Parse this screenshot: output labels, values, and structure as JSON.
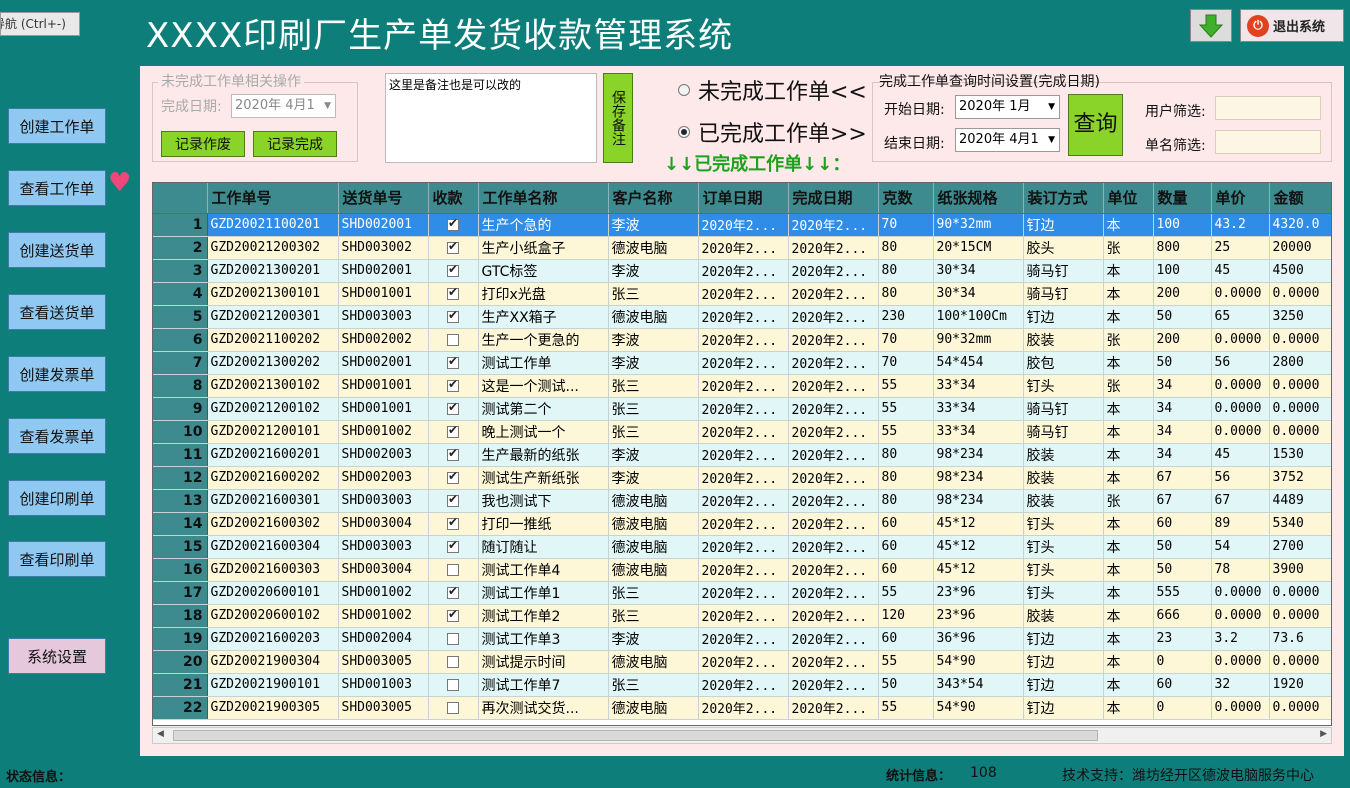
{
  "nav_hint": "导航 (Ctrl+-)",
  "title": "XXXX印刷厂生产单发货收款管理系统",
  "exit_label": "退出系统",
  "sidebar": [
    {
      "label": "创建工作单"
    },
    {
      "label": "查看工作单"
    },
    {
      "label": "创建送货单"
    },
    {
      "label": "查看送货单"
    },
    {
      "label": "创建发票单"
    },
    {
      "label": "查看发票单"
    },
    {
      "label": "创建印刷单"
    },
    {
      "label": "查看印刷单"
    }
  ],
  "settings_label": "系统设置",
  "unfinished": {
    "group_title": "未完成工作单相关操作",
    "date_label": "完成日期:",
    "date_value": "2020年 4月1",
    "void_label": "记录作废",
    "complete_label": "记录完成"
  },
  "memo": {
    "text": "这里是备注也是可以改的",
    "save_label": "保存备注"
  },
  "radios": {
    "unfinished_label": "未完成工作单<<",
    "finished_label": "已完成工作单>>",
    "selected": "finished",
    "banner": "↓↓已完成工作单↓↓："
  },
  "query": {
    "group_title": "完成工作单查询时间设置(完成日期)",
    "start_label": "开始日期:",
    "start_value": "2020年 1月",
    "end_label": "结束日期:",
    "end_value": "2020年 4月1",
    "button_label": "查询",
    "user_filter_label": "用户筛选:",
    "name_filter_label": "单名筛选:"
  },
  "grid": {
    "columns": [
      "",
      "工作单号",
      "送货单号",
      "收款",
      "工作单名称",
      "客户名称",
      "订单日期",
      "完成日期",
      "克数",
      "纸张规格",
      "装订方式",
      "单位",
      "数量",
      "单价",
      "金额"
    ],
    "rows": [
      [
        "1",
        "GZD20021100201",
        "SHD002001",
        true,
        "生产个急的",
        "李波",
        "2020年2...",
        "2020年2...",
        "70",
        "90*32mm",
        "钉边",
        "本",
        "100",
        "43.2",
        "4320.0"
      ],
      [
        "2",
        "GZD20021200302",
        "SHD003002",
        true,
        "生产小纸盒子",
        "德波电脑",
        "2020年2...",
        "2020年2...",
        "80",
        "20*15CM",
        "胶头",
        "张",
        "800",
        "25",
        "20000"
      ],
      [
        "3",
        "GZD20021300201",
        "SHD002001",
        true,
        "GTC标签",
        "李波",
        "2020年2...",
        "2020年2...",
        "80",
        "30*34",
        "骑马钉",
        "本",
        "100",
        "45",
        "4500"
      ],
      [
        "4",
        "GZD20021300101",
        "SHD001001",
        true,
        "打印x光盘",
        "张三",
        "2020年2...",
        "2020年2...",
        "80",
        "30*34",
        "骑马钉",
        "本",
        "200",
        "0.0000",
        "0.0000"
      ],
      [
        "5",
        "GZD20021200301",
        "SHD003003",
        true,
        "生产XX箱子",
        "德波电脑",
        "2020年2...",
        "2020年2...",
        "230",
        "100*100Cm",
        "钉边",
        "本",
        "50",
        "65",
        "3250"
      ],
      [
        "6",
        "GZD20021100202",
        "SHD002002",
        false,
        "生产一个更急的",
        "李波",
        "2020年2...",
        "2020年2...",
        "70",
        "90*32mm",
        "胶装",
        "张",
        "200",
        "0.0000",
        "0.0000"
      ],
      [
        "7",
        "GZD20021300202",
        "SHD002001",
        true,
        "测试工作单",
        "李波",
        "2020年2...",
        "2020年2...",
        "70",
        "54*454",
        "胶包",
        "本",
        "50",
        "56",
        "2800"
      ],
      [
        "8",
        "GZD20021300102",
        "SHD001001",
        true,
        "这是一个测试...",
        "张三",
        "2020年2...",
        "2020年2...",
        "55",
        "33*34",
        "钉头",
        "张",
        "34",
        "0.0000",
        "0.0000"
      ],
      [
        "9",
        "GZD20021200102",
        "SHD001001",
        true,
        "测试第二个",
        "张三",
        "2020年2...",
        "2020年2...",
        "55",
        "33*34",
        "骑马钉",
        "本",
        "34",
        "0.0000",
        "0.0000"
      ],
      [
        "10",
        "GZD20021200101",
        "SHD001002",
        true,
        "晚上测试一个",
        "张三",
        "2020年2...",
        "2020年2...",
        "55",
        "33*34",
        "骑马钉",
        "本",
        "34",
        "0.0000",
        "0.0000"
      ],
      [
        "11",
        "GZD20021600201",
        "SHD002003",
        true,
        "生产最新的纸张",
        "李波",
        "2020年2...",
        "2020年2...",
        "80",
        "98*234",
        "胶装",
        "本",
        "34",
        "45",
        "1530"
      ],
      [
        "12",
        "GZD20021600202",
        "SHD002003",
        true,
        "测试生产新纸张",
        "李波",
        "2020年2...",
        "2020年2...",
        "80",
        "98*234",
        "胶装",
        "本",
        "67",
        "56",
        "3752"
      ],
      [
        "13",
        "GZD20021600301",
        "SHD003003",
        true,
        "我也测试下",
        "德波电脑",
        "2020年2...",
        "2020年2...",
        "80",
        "98*234",
        "胶装",
        "张",
        "67",
        "67",
        "4489"
      ],
      [
        "14",
        "GZD20021600302",
        "SHD003004",
        true,
        "打印一推纸",
        "德波电脑",
        "2020年2...",
        "2020年2...",
        "60",
        "45*12",
        "钉头",
        "本",
        "60",
        "89",
        "5340"
      ],
      [
        "15",
        "GZD20021600304",
        "SHD003003",
        true,
        "随订随让",
        "德波电脑",
        "2020年2...",
        "2020年2...",
        "60",
        "45*12",
        "钉头",
        "本",
        "50",
        "54",
        "2700"
      ],
      [
        "16",
        "GZD20021600303",
        "SHD003004",
        false,
        "测试工作单4",
        "德波电脑",
        "2020年2...",
        "2020年2...",
        "60",
        "45*12",
        "钉头",
        "本",
        "50",
        "78",
        "3900"
      ],
      [
        "17",
        "GZD20020600101",
        "SHD001002",
        true,
        "测试工作单1",
        "张三",
        "2020年2...",
        "2020年2...",
        "55",
        "23*96",
        "钉头",
        "本",
        "555",
        "0.0000",
        "0.0000"
      ],
      [
        "18",
        "GZD20020600102",
        "SHD001002",
        true,
        "测试工作单2",
        "张三",
        "2020年2...",
        "2020年2...",
        "120",
        "23*96",
        "胶装",
        "本",
        "666",
        "0.0000",
        "0.0000"
      ],
      [
        "19",
        "GZD20021600203",
        "SHD002004",
        false,
        "测试工作单3",
        "李波",
        "2020年2...",
        "2020年2...",
        "60",
        "36*96",
        "钉边",
        "本",
        "23",
        "3.2",
        "73.6"
      ],
      [
        "20",
        "GZD20021900304",
        "SHD003005",
        false,
        "测试提示时间",
        "德波电脑",
        "2020年2...",
        "2020年2...",
        "55",
        "54*90",
        "钉边",
        "本",
        "0",
        "0.0000",
        "0.0000"
      ],
      [
        "21",
        "GZD20021900101",
        "SHD001003",
        false,
        "测试工作单7",
        "张三",
        "2020年2...",
        "2020年2...",
        "50",
        "343*54",
        "钉边",
        "本",
        "60",
        "32",
        "1920"
      ],
      [
        "22",
        "GZD20021900305",
        "SHD003005",
        false,
        "再次测试交货...",
        "德波电脑",
        "2020年2...",
        "2020年2...",
        "55",
        "54*90",
        "钉边",
        "本",
        "0",
        "0.0000",
        "0.0000"
      ]
    ]
  },
  "footer": {
    "status_label": "状态信息：",
    "stats_label": "统计信息：",
    "stats_value": "108",
    "support": "技术支持：潍坊经开区德波电脑服务中心"
  }
}
